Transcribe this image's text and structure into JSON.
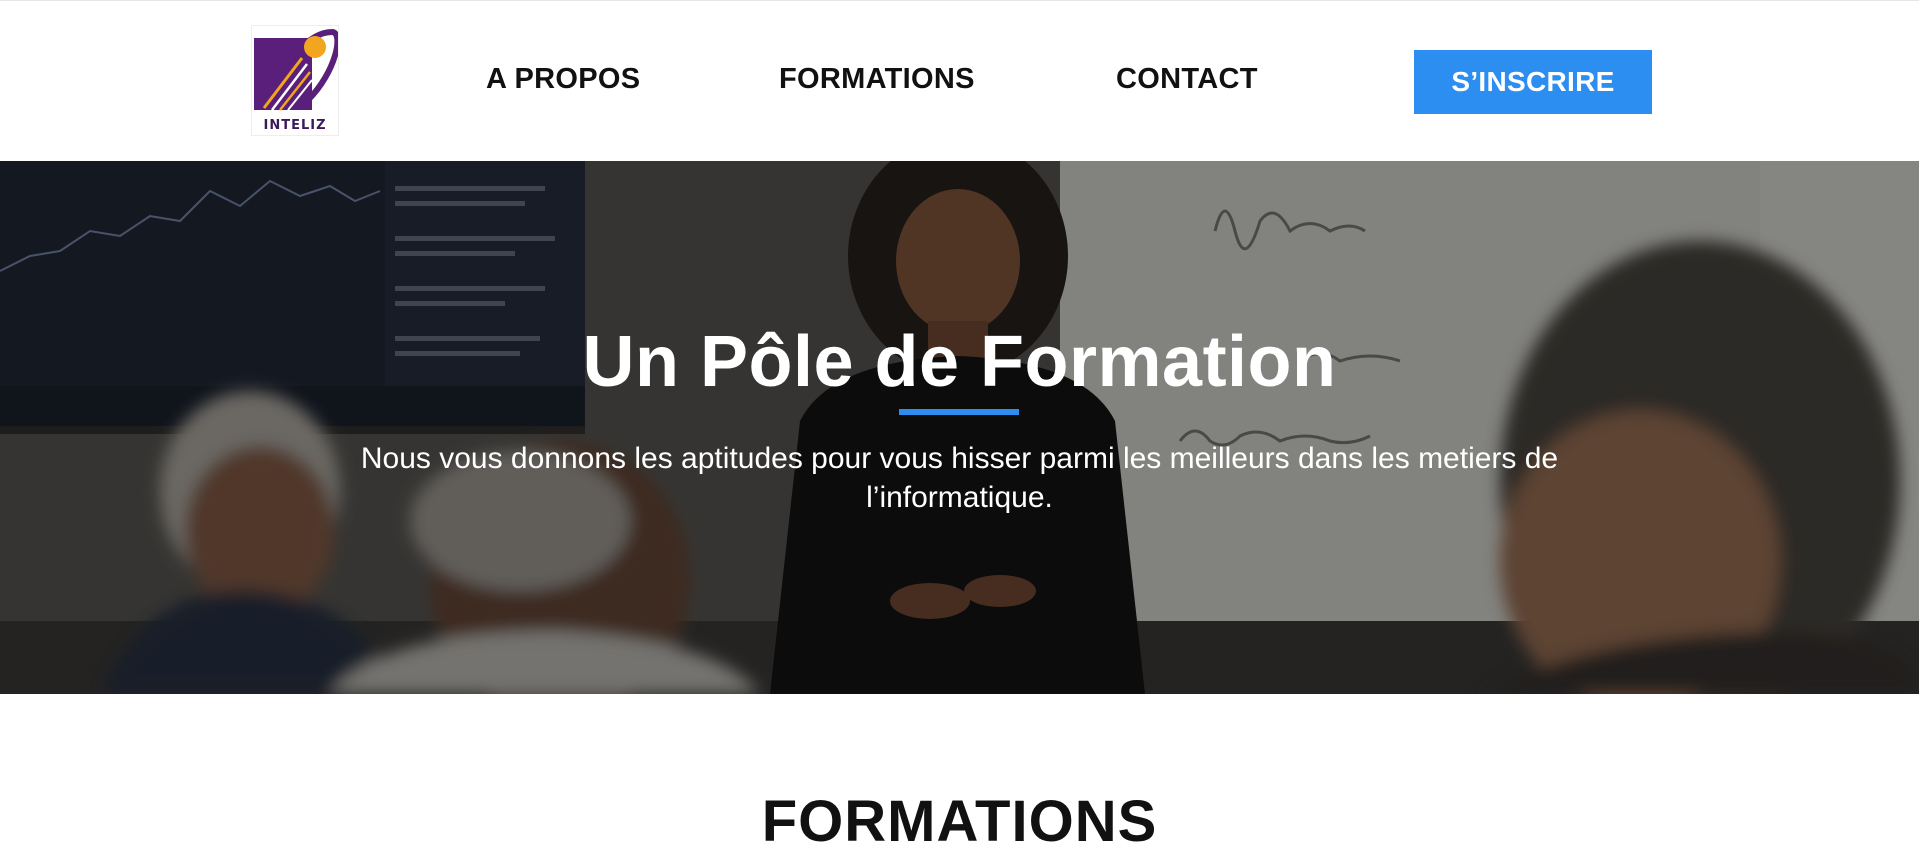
{
  "header": {
    "logo_text": "INTELIZ",
    "nav": [
      {
        "label": "A PROPOS"
      },
      {
        "label": "FORMATIONS"
      },
      {
        "label": "CONTACT"
      }
    ],
    "cta_label": "S’INSCRIRE"
  },
  "hero": {
    "title": "Un Pôle de Formation",
    "subtitle": "Nous vous donnons les aptitudes pour vous hisser parmi les meilleurs dans les metiers de l’informatique."
  },
  "section": {
    "title": "FORMATIONS"
  },
  "colors": {
    "accent": "#2b8ef0",
    "logo_purple": "#5a1f7a",
    "logo_orange": "#f2a51f",
    "text_dark": "#111111"
  }
}
